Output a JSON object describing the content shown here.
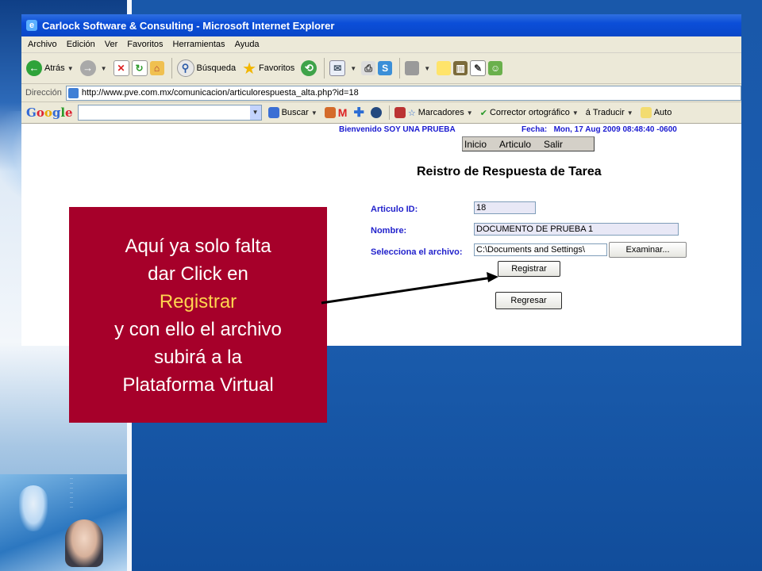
{
  "window": {
    "title": "Carlock Software & Consulting - Microsoft Internet Explorer"
  },
  "menu": [
    "Archivo",
    "Edición",
    "Ver",
    "Favoritos",
    "Herramientas",
    "Ayuda"
  ],
  "toolbar": {
    "back": "Atrás",
    "search": "Búsqueda",
    "favorites": "Favoritos"
  },
  "address": {
    "label": "Dirección",
    "url": "http://www.pve.com.mx/comunicacion/articulorespuesta_alta.php?id=18"
  },
  "googlebar": {
    "logo": "Google",
    "search": "Buscar",
    "bookmarks": "Marcadores",
    "spellcheck": "Corrector ortográfico",
    "translate": "Traducir",
    "auto": "Auto"
  },
  "page": {
    "welcome": "Bienvenido SOY UNA PRUEBA",
    "date": "Fecha:   Mon, 17 Aug 2009 08:48:40 -0600",
    "nav": [
      "Inicio",
      "Articulo",
      "Salir"
    ],
    "title": "Reistro de Respuesta de Tarea",
    "fields": {
      "articulo_label": "Articulo ID:",
      "articulo_value": "18",
      "nombre_label": "Nombre:",
      "nombre_value": "DOCUMENTO DE PRUEBA 1",
      "archivo_label": "Selecciona el archivo:",
      "archivo_value": "C:\\Documents and Settings\\"
    },
    "buttons": {
      "browse": "Examinar...",
      "submit": "Registrar",
      "back": "Regresar"
    }
  },
  "callout": {
    "line1": "Aquí ya solo falta",
    "line2": "dar Click en",
    "highlight": "Registrar",
    "line3": "y con ello el archivo",
    "line4": "subirá a la",
    "line5": "Plataforma Virtual"
  },
  "colors": {
    "callout_bg": "#a6002a",
    "highlight": "#ffd54f",
    "label_blue": "#2222cc"
  }
}
